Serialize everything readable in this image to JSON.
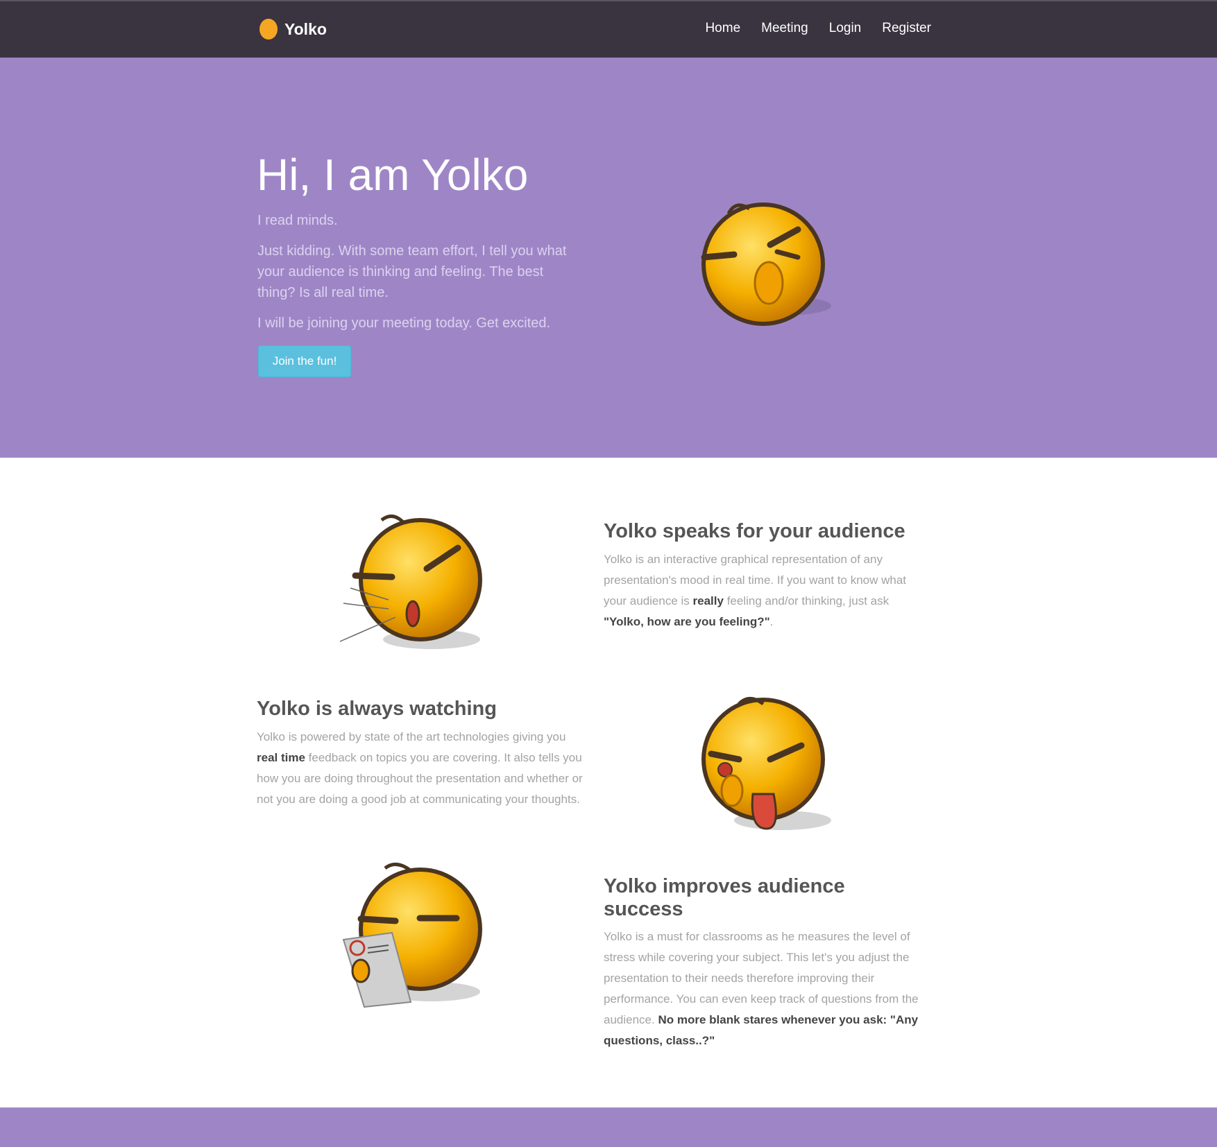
{
  "brand": {
    "name": "Yolko",
    "dot_color": "#f5a623"
  },
  "nav": {
    "items": [
      "Home",
      "Meeting",
      "Login",
      "Register"
    ]
  },
  "hero": {
    "title": "Hi, I am Yolko",
    "line1": "I read minds.",
    "line2": "Just kidding. With some team effort, I tell you what your audience is thinking and feeling. The best thing? Is all real time.",
    "line3": "I will be joining your meeting today. Get excited.",
    "button": "Join the fun!",
    "bg_color": "#9e86c6"
  },
  "features": [
    {
      "title": "Yolko speaks for your audience",
      "text_a": "Yolko is an interactive graphical representation of any presentation's mood in real time. If you want to know what your audience is ",
      "bold_a": "really",
      "text_b": " feeling and/or thinking, just ask ",
      "bold_b": "\"Yolko, how are you feeling?\"",
      "text_c": "."
    },
    {
      "title": "Yolko is always watching",
      "text_a": "Yolko is powered by state of the art technologies giving you ",
      "bold_a": "real time",
      "text_b": " feedback on topics you are covering. It also tells you how you are doing throughout the presentation and whether or not you are doing a good job at communicating your thoughts."
    },
    {
      "title": "Yolko improves audience success",
      "text_a": "Yolko is a must for classrooms as he measures the level of stress while covering your subject. This let's you adjust the presentation to their needs therefore improving their performance. You can even keep track of questions from the audience. ",
      "bold_a": "No more blank stares whenever you ask: \"Any questions, class..?\""
    }
  ],
  "icons": [
    "emoji-face-nose-pick",
    "emoji-face-blowing",
    "emoji-face-tongue-out",
    "emoji-face-sweating-paper"
  ]
}
